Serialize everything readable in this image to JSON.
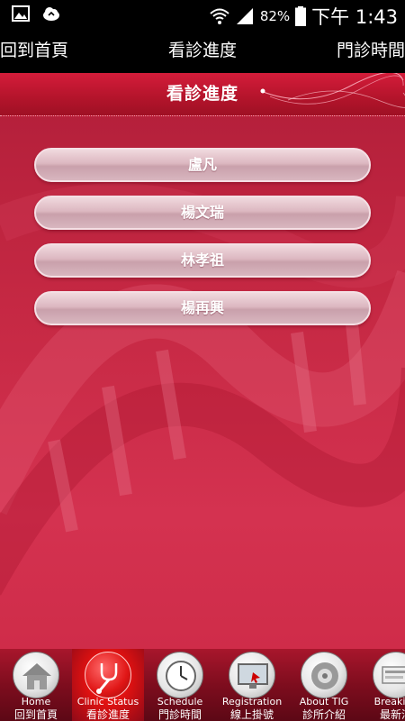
{
  "status_bar": {
    "battery_percent": "82%",
    "time": "下午 1:43",
    "icons": [
      "gallery-icon",
      "cloud-icon",
      "wifi-icon",
      "signal-icon",
      "battery-icon"
    ]
  },
  "top_tabs": {
    "left": "回到首頁",
    "center": "看診進度",
    "right": "門診時間"
  },
  "header": {
    "title": "看診進度"
  },
  "doctors": [
    {
      "name": "盧凡"
    },
    {
      "name": "楊文瑞"
    },
    {
      "name": "林孝祖"
    },
    {
      "name": "楊再興"
    }
  ],
  "bottom_nav": [
    {
      "en": "Home",
      "zh": "回到首頁",
      "icon": "home-icon",
      "active": false
    },
    {
      "en": "Clinic Status",
      "zh": "看診進度",
      "icon": "stethoscope-icon",
      "active": true
    },
    {
      "en": "Schedule",
      "zh": "門診時間",
      "icon": "clock-icon",
      "active": false
    },
    {
      "en": "Registration",
      "zh": "線上掛號",
      "icon": "monitor-icon",
      "active": false
    },
    {
      "en": "About TIG",
      "zh": "診所介紹",
      "icon": "info-disc-icon",
      "active": false
    },
    {
      "en": "Breaking",
      "zh": "最新消",
      "icon": "news-icon",
      "active": false
    }
  ],
  "colors": {
    "header_red": "#b3142b",
    "content_red": "#c52843",
    "active_tab_red": "#e01616",
    "button_pink": "#dcb7c0"
  }
}
